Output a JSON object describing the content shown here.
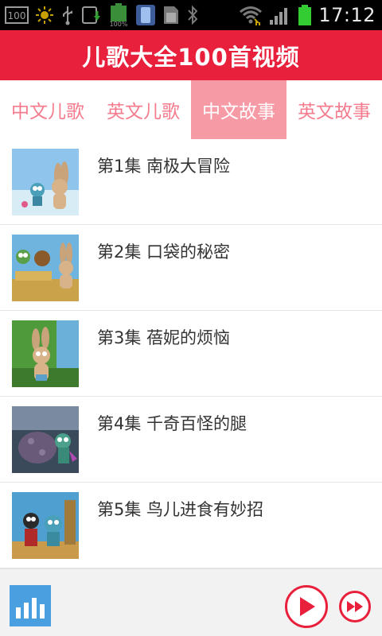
{
  "status_bar": {
    "time": "17:12",
    "battery_small_label": "100%",
    "icons": [
      "screenshot-100-icon",
      "brightness-icon",
      "usb-icon",
      "sync-icon",
      "battery-full-icon",
      "phone-icon",
      "sd-card-icon",
      "bluetooth-icon",
      "wifi-icon",
      "signal-icon",
      "battery-icon"
    ]
  },
  "header": {
    "title": "儿歌大全100首视频"
  },
  "tabs": [
    {
      "label": "中文儿歌",
      "active": false
    },
    {
      "label": "英文儿歌",
      "active": false
    },
    {
      "label": "中文故事",
      "active": true
    },
    {
      "label": "英文故事",
      "active": false
    }
  ],
  "episodes": [
    {
      "title": "第1集 南极大冒险"
    },
    {
      "title": "第2集 口袋的秘密"
    },
    {
      "title": "第3集 蓓妮的烦恼"
    },
    {
      "title": "第4集 千奇百怪的腿"
    },
    {
      "title": "第5集 鸟儿进食有妙招"
    }
  ],
  "player": {
    "icons": [
      "equalizer-icon",
      "play-icon",
      "fast-forward-icon"
    ]
  },
  "colors": {
    "header": "#e8203c",
    "tab_text": "#f47c8e",
    "tab_active_bg": "#f69aa6",
    "eq_button": "#4a9fe0",
    "player_accent": "#e8203c"
  }
}
